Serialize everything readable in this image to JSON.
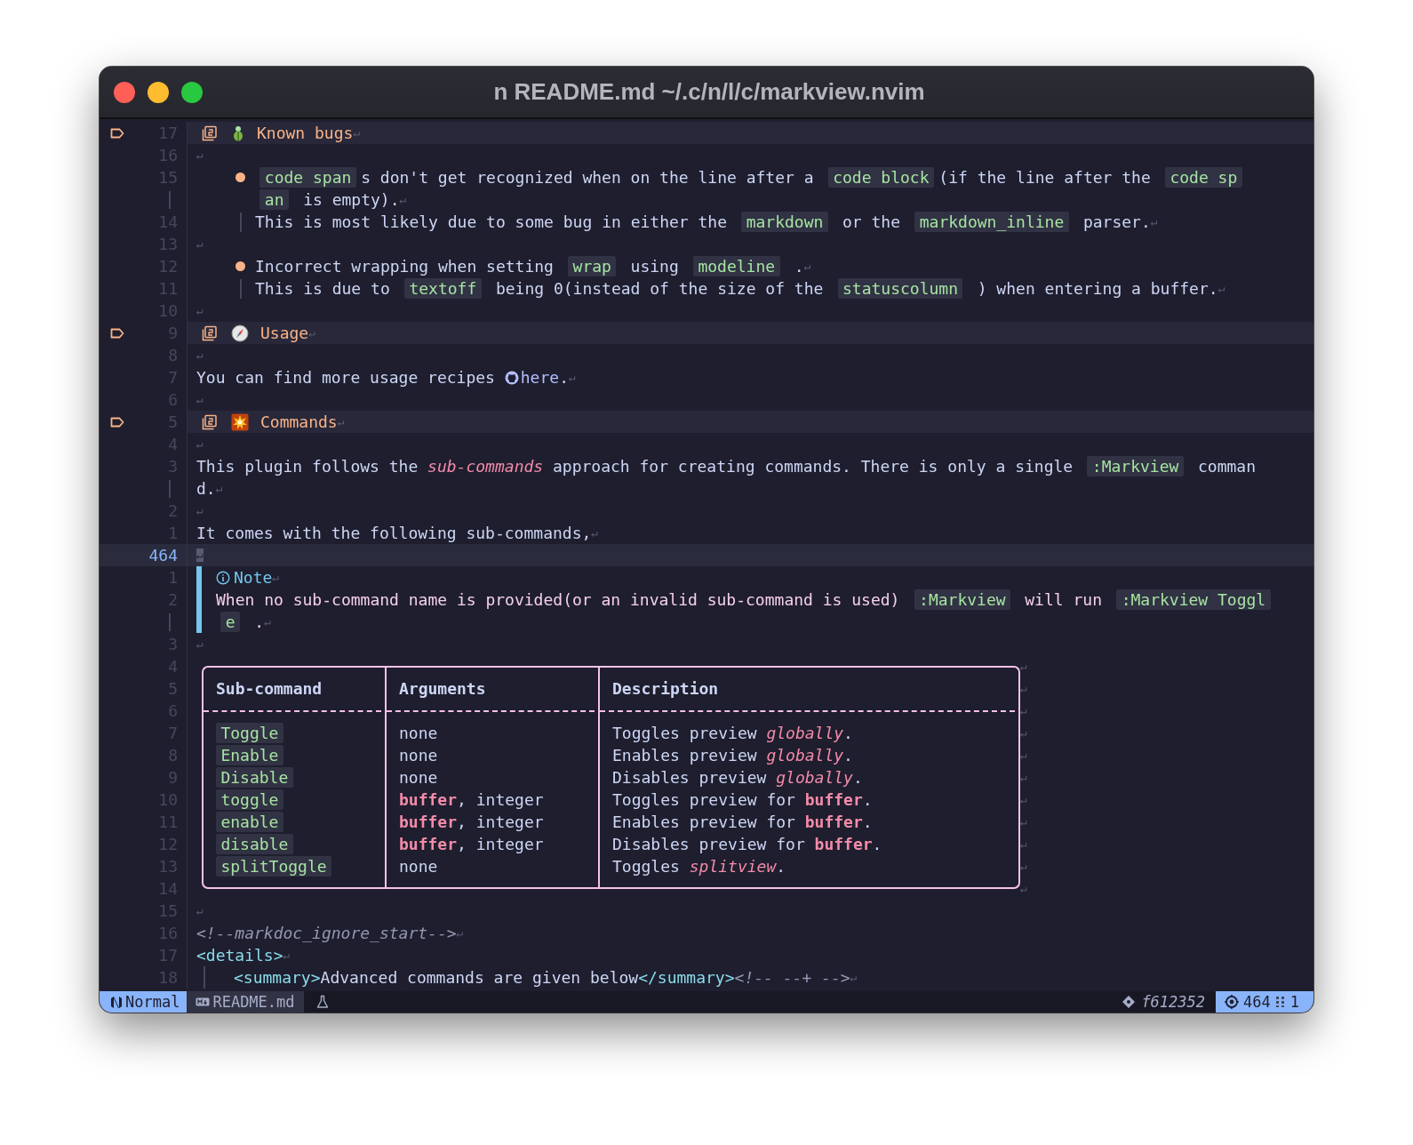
{
  "window": {
    "title": "n README.md ~/.c/n/l/c/markview.nvim"
  },
  "lines": [
    {
      "num": "17",
      "sign": true,
      "current": false,
      "kind": "heading",
      "segs": [
        {
          "text": "Known bugs",
          "kind": "heading"
        }
      ],
      "eol": "↵"
    },
    {
      "num": "16",
      "sign": false,
      "current": false,
      "kind": "blank",
      "eol": "↵"
    },
    {
      "num": "15",
      "sign": false,
      "current": false,
      "kind": "bullet",
      "segs": [
        {
          "text": "code span",
          "kind": "code"
        },
        {
          "text": "s don't get recognized when on the line after a ",
          "kind": "plain"
        },
        {
          "text": "code block",
          "kind": "code"
        },
        {
          "text": "(if the line after the ",
          "kind": "plain"
        },
        {
          "text": "code sp",
          "kind": "code"
        }
      ]
    },
    {
      "sign": false,
      "current": false,
      "kind": "item_wrap",
      "segs": [
        {
          "text": "an",
          "kind": "code"
        },
        {
          "text": " is empty).",
          "kind": "plain"
        }
      ],
      "eol": "↵"
    },
    {
      "num": "14",
      "sign": false,
      "current": false,
      "kind": "item_text",
      "segs": [
        {
          "text": "This is most likely due to some bug in either the ",
          "kind": "plain"
        },
        {
          "text": "markdown",
          "kind": "code"
        },
        {
          "text": " or the ",
          "kind": "plain"
        },
        {
          "text": "markdown_inline",
          "kind": "code"
        },
        {
          "text": " parser.",
          "kind": "plain"
        }
      ],
      "eol": "↵"
    },
    {
      "num": "13",
      "sign": false,
      "current": false,
      "kind": "blank",
      "eol": "↵"
    },
    {
      "num": "12",
      "sign": false,
      "current": false,
      "kind": "bullet",
      "segs": [
        {
          "text": "Incorrect wrapping when setting ",
          "kind": "plain"
        },
        {
          "text": "wrap",
          "kind": "code"
        },
        {
          "text": " using ",
          "kind": "plain"
        },
        {
          "text": "modeline",
          "kind": "code"
        },
        {
          "text": " .",
          "kind": "plain"
        }
      ],
      "eol": "↵"
    },
    {
      "num": "11",
      "sign": false,
      "current": false,
      "kind": "item_text",
      "segs": [
        {
          "text": "This is due to ",
          "kind": "plain"
        },
        {
          "text": "textoff",
          "kind": "code"
        },
        {
          "text": " being 0(instead of the size of the ",
          "kind": "plain"
        },
        {
          "text": "statuscolumn",
          "kind": "code"
        },
        {
          "text": " ) when entering a buffer.",
          "kind": "plain"
        }
      ],
      "eol": "↵"
    },
    {
      "num": "10",
      "sign": false,
      "current": false,
      "kind": "blank",
      "eol": "↵"
    },
    {
      "num": "9",
      "sign": true,
      "current": false,
      "kind": "heading",
      "segs": [
        {
          "text": "Usage",
          "kind": "heading"
        }
      ],
      "eol": "↵"
    },
    {
      "num": "8",
      "sign": false,
      "current": false,
      "kind": "blank",
      "eol": "↵"
    },
    {
      "num": "7",
      "sign": false,
      "current": false,
      "kind": "text",
      "segs": [
        {
          "text": "You can find more usage recipes ",
          "kind": "plain"
        },
        {
          "text": "here",
          "kind": "link"
        },
        {
          "text": ".",
          "kind": "plain"
        }
      ],
      "eol": "↵"
    },
    {
      "num": "6",
      "sign": false,
      "current": false,
      "kind": "blank",
      "eol": "↵"
    },
    {
      "num": "5",
      "sign": true,
      "current": false,
      "kind": "heading",
      "segs": [
        {
          "text": "Commands",
          "kind": "heading"
        }
      ],
      "eol": "↵"
    },
    {
      "num": "4",
      "sign": false,
      "current": false,
      "kind": "blank",
      "eol": "↵"
    },
    {
      "num": "3",
      "sign": false,
      "current": false,
      "kind": "text",
      "segs": [
        {
          "text": "This plugin follows the ",
          "kind": "plain"
        },
        {
          "text": "sub-commands",
          "kind": "italic"
        },
        {
          "text": " approach for creating commands. There is only a single ",
          "kind": "plain"
        },
        {
          "text": ":Markview",
          "kind": "code"
        },
        {
          "text": " comman",
          "kind": "plain"
        }
      ]
    },
    {
      "sign": false,
      "current": false,
      "kind": "text",
      "segs": [
        {
          "text": "d.",
          "kind": "plain"
        }
      ],
      "eol": "↵"
    },
    {
      "num": "2",
      "sign": false,
      "current": false,
      "kind": "blank",
      "eol": "↵"
    },
    {
      "num": "1",
      "sign": false,
      "current": false,
      "kind": "text",
      "segs": [
        {
          "text": "It comes with the following sub-commands,",
          "kind": "plain"
        }
      ],
      "eol": "↵"
    },
    {
      "num": "464",
      "sign": false,
      "current": true,
      "kind": "blank",
      "eol": "↵"
    },
    {
      "num": "1",
      "sign": false,
      "current": false,
      "kind": "callout_title",
      "segs": [
        {
          "text": "Note",
          "kind": "note"
        }
      ],
      "eol": "↵"
    },
    {
      "num": "2",
      "sign": false,
      "current": false,
      "kind": "callout_text",
      "segs": [
        {
          "text": "When no sub-command name is provided(or an invalid sub-command is used) ",
          "kind": "callout"
        },
        {
          "text": ":Markview",
          "kind": "code"
        },
        {
          "text": " will run ",
          "kind": "callout"
        },
        {
          "text": ":Markview Toggl",
          "kind": "code"
        }
      ]
    },
    {
      "sign": false,
      "current": false,
      "kind": "callout_text",
      "segs": [
        {
          "text": "e",
          "kind": "code"
        },
        {
          "text": " .",
          "kind": "callout"
        }
      ],
      "eol": "↵"
    },
    {
      "num": "3",
      "sign": false,
      "current": false,
      "kind": "blank",
      "eol": "↵"
    },
    {
      "num": "4",
      "sign": false,
      "current": false,
      "kind": "table_top",
      "eol": "↵"
    },
    {
      "num": "5",
      "sign": false,
      "current": false,
      "kind": "table_head",
      "cells": [
        "Sub-command",
        "Arguments",
        "Description"
      ],
      "eol": "↵"
    },
    {
      "num": "6",
      "sign": false,
      "current": false,
      "kind": "table_sep",
      "eol": "↵"
    },
    {
      "num": "7",
      "sign": false,
      "current": false,
      "kind": "table_row",
      "cells": [
        "Toggle",
        "none",
        "Toggles preview *globally*."
      ],
      "eol": "↵"
    },
    {
      "num": "8",
      "sign": false,
      "current": false,
      "kind": "table_row",
      "cells": [
        "Enable",
        "none",
        "Enables preview *globally*."
      ],
      "eol": "↵"
    },
    {
      "num": "9",
      "sign": false,
      "current": false,
      "kind": "table_row",
      "cells": [
        "Disable",
        "none",
        "Disables preview *globally*."
      ],
      "eol": "↵"
    },
    {
      "num": "10",
      "sign": false,
      "current": false,
      "kind": "table_row",
      "cells": [
        "toggle",
        "**buffer**, integer",
        "Toggles preview for **buffer**."
      ],
      "eol": "↵"
    },
    {
      "num": "11",
      "sign": false,
      "current": false,
      "kind": "table_row",
      "cells": [
        "enable",
        "**buffer**, integer",
        "Enables preview for **buffer**."
      ],
      "eol": "↵"
    },
    {
      "num": "12",
      "sign": false,
      "current": false,
      "kind": "table_row",
      "cells": [
        "disable",
        "**buffer**, integer",
        "Disables preview for **buffer**."
      ],
      "eol": "↵"
    },
    {
      "num": "13",
      "sign": false,
      "current": false,
      "kind": "table_row",
      "cells": [
        "splitToggle",
        "none",
        "Toggles *splitview*."
      ],
      "eol": "↵"
    },
    {
      "num": "14",
      "sign": false,
      "current": false,
      "kind": "table_bottom",
      "eol": "↵"
    },
    {
      "num": "15",
      "sign": false,
      "current": false,
      "kind": "blank",
      "eol": "↵"
    },
    {
      "num": "16",
      "sign": false,
      "current": false,
      "kind": "html",
      "segs": [
        {
          "text": "<!--markdoc_ignore_start-->",
          "kind": "comment"
        }
      ],
      "eol": "↵"
    },
    {
      "num": "17",
      "sign": false,
      "current": false,
      "kind": "html",
      "segs": [
        {
          "text": "<details>",
          "kind": "tag"
        }
      ],
      "eol": "↵"
    },
    {
      "num": "18",
      "sign": false,
      "current": false,
      "kind": "html_indent",
      "segs": [
        {
          "text": "<summary>",
          "kind": "tag"
        },
        {
          "text": "Advanced commands are given below",
          "kind": "plain"
        },
        {
          "text": "</summary>",
          "kind": "tag"
        },
        {
          "text": "<!-- --+ -->",
          "kind": "comment"
        }
      ],
      "eol": "↵"
    }
  ],
  "status_bar": {
    "mode": "Normal",
    "file": "README.md",
    "commit": "f612352",
    "line": "464",
    "column": "1"
  }
}
